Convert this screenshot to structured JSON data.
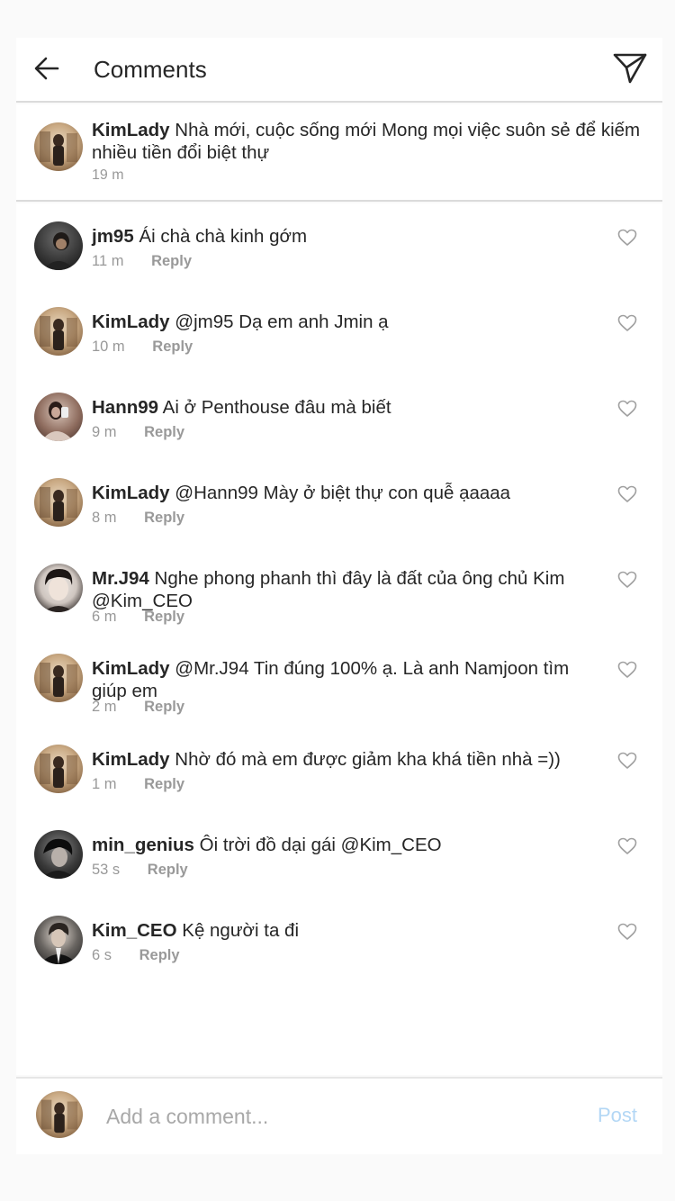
{
  "header": {
    "title": "Comments",
    "back_icon": "arrow-left-icon",
    "send_icon": "paper-plane-icon"
  },
  "caption": {
    "username": "KimLady",
    "text": "Nhà mới, cuộc sống mới Mong mọi việc suôn sẻ để kiếm nhiều tiền đổi biệt thự",
    "time": "19 m"
  },
  "comments": [
    {
      "username": "jm95",
      "text": "Ái chà chà kinh gớm",
      "time": "11 m",
      "reply": "Reply"
    },
    {
      "username": "KimLady",
      "text": "@jm95 Dạ em anh Jmin ạ",
      "time": "10 m",
      "reply": "Reply"
    },
    {
      "username": "Hann99",
      "text": "Ai ở Penthouse đâu mà biết",
      "time": "9 m",
      "reply": "Reply"
    },
    {
      "username": "KimLady",
      "text": "@Hann99 Mày ở biệt thự con quễ ạaaaa",
      "time": "8 m",
      "reply": "Reply"
    },
    {
      "username": "Mr.J94",
      "text": "Nghe phong phanh thì đây là đất của ông chủ Kim @Kim_CEO",
      "time": "6 m",
      "reply": "Reply"
    },
    {
      "username": "KimLady",
      "text": "@Mr.J94 Tin đúng 100% ạ. Là anh Namjoon tìm giúp em",
      "time": "2 m",
      "reply": "Reply"
    },
    {
      "username": "KimLady",
      "text": "Nhờ đó mà em được giảm kha khá tiền nhà =))",
      "time": "1 m",
      "reply": "Reply"
    },
    {
      "username": "min_genius",
      "text": "Ôi trời đồ dại gái @Kim_CEO",
      "time": "53 s",
      "reply": "Reply"
    },
    {
      "username": "Kim_CEO",
      "text": "Kệ người ta đi",
      "time": "6 s",
      "reply": "Reply"
    }
  ],
  "input": {
    "placeholder": "Add a comment...",
    "post_label": "Post"
  },
  "colors": {
    "text": "#262626",
    "muted": "#999999",
    "divider": "#dbdbdb",
    "post_disabled": "#b3d7f5"
  }
}
